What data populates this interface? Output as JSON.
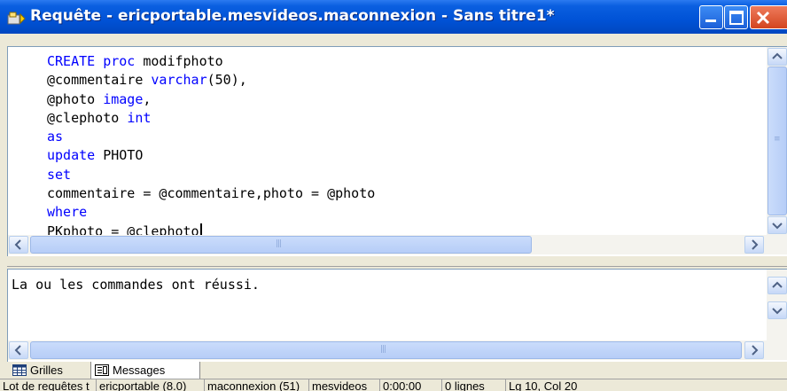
{
  "window": {
    "title": "Requête - ericportable.mesvideos.maconnexion - Sans titre1*"
  },
  "editor": {
    "lines": [
      [
        {
          "t": "CREATE",
          "k": 1
        },
        {
          "t": " "
        },
        {
          "t": "proc",
          "k": 1
        },
        {
          "t": " modifphoto"
        }
      ],
      [
        {
          "t": "@commentaire "
        },
        {
          "t": "varchar",
          "k": 1
        },
        {
          "t": "(50),"
        }
      ],
      [
        {
          "t": "@photo "
        },
        {
          "t": "image",
          "k": 1
        },
        {
          "t": ","
        }
      ],
      [
        {
          "t": "@clephoto "
        },
        {
          "t": "int",
          "k": 1
        }
      ],
      [
        {
          "t": "as",
          "k": 1
        }
      ],
      [
        {
          "t": "update",
          "k": 1
        },
        {
          "t": " PHOTO"
        }
      ],
      [
        {
          "t": "set",
          "k": 1
        }
      ],
      [
        {
          "t": "commentaire = @commentaire,photo = @photo"
        }
      ],
      [
        {
          "t": "where",
          "k": 1
        }
      ],
      [
        {
          "t": "PKphoto = @clephoto"
        }
      ]
    ],
    "caret_line": 9
  },
  "results": {
    "message": "La ou les commandes ont réussi."
  },
  "tabs": [
    {
      "label": "Grilles",
      "icon": "grid-icon"
    },
    {
      "label": "Messages",
      "icon": "messages-icon",
      "selected": true
    }
  ],
  "statusbar": {
    "panels": [
      "Lot de requêtes t",
      "ericportable (8.0)",
      "maconnexion (51)",
      "mesvideos",
      "0:00:00",
      "0 lignes",
      "Lg 10, Col 20"
    ]
  }
}
